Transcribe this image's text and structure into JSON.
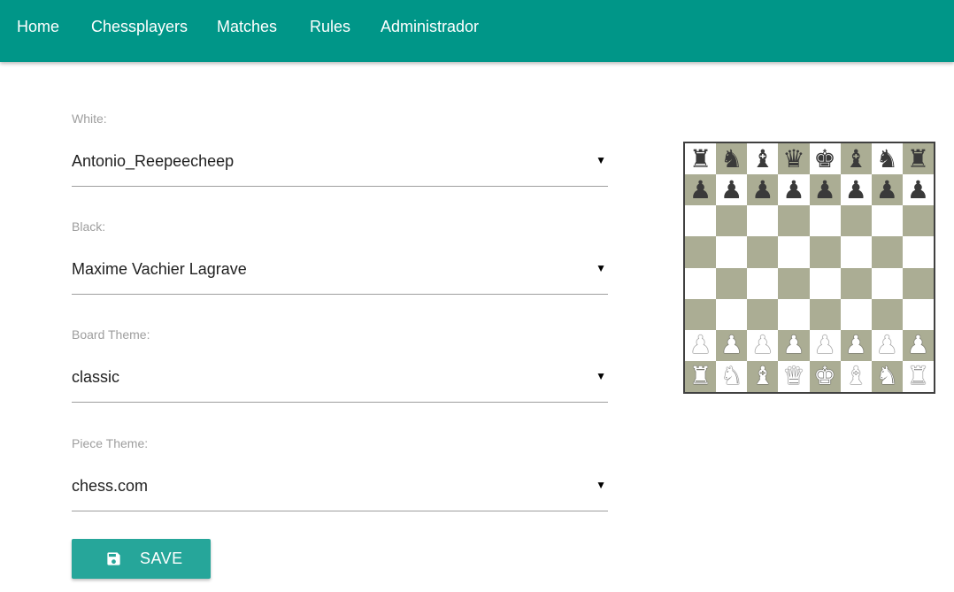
{
  "nav": {
    "items": [
      {
        "label": "Home"
      },
      {
        "label": "Chessplayers"
      },
      {
        "label": "Matches"
      },
      {
        "label": "Rules"
      },
      {
        "label": "Administrador"
      }
    ]
  },
  "form": {
    "white": {
      "label": "White:",
      "value": "Antonio_Reepeecheep"
    },
    "black": {
      "label": "Black:",
      "value": "Maxime Vachier Lagrave"
    },
    "board_theme": {
      "label": "Board Theme:",
      "value": "classic"
    },
    "piece_theme": {
      "label": "Piece Theme:",
      "value": "chess.com"
    },
    "caret": "▼",
    "save": {
      "label": "SAVE",
      "icon": "floppy-disk-icon"
    }
  },
  "board": {
    "colors": {
      "light": "#ffffff",
      "dark": "#abad94"
    },
    "position": [
      [
        "bR",
        "bN",
        "bB",
        "bQ",
        "bK",
        "bB",
        "bN",
        "bR"
      ],
      [
        "bP",
        "bP",
        "bP",
        "bP",
        "bP",
        "bP",
        "bP",
        "bP"
      ],
      [
        "",
        "",
        "",
        "",
        "",
        "",
        "",
        ""
      ],
      [
        "",
        "",
        "",
        "",
        "",
        "",
        "",
        ""
      ],
      [
        "",
        "",
        "",
        "",
        "",
        "",
        "",
        ""
      ],
      [
        "",
        "",
        "",
        "",
        "",
        "",
        "",
        ""
      ],
      [
        "wP",
        "wP",
        "wP",
        "wP",
        "wP",
        "wP",
        "wP",
        "wP"
      ],
      [
        "wR",
        "wN",
        "wB",
        "wQ",
        "wK",
        "wB",
        "wN",
        "wR"
      ]
    ]
  },
  "colors": {
    "navbar": "#009688",
    "button": "#26a69a",
    "label": "#9e9e9e"
  }
}
